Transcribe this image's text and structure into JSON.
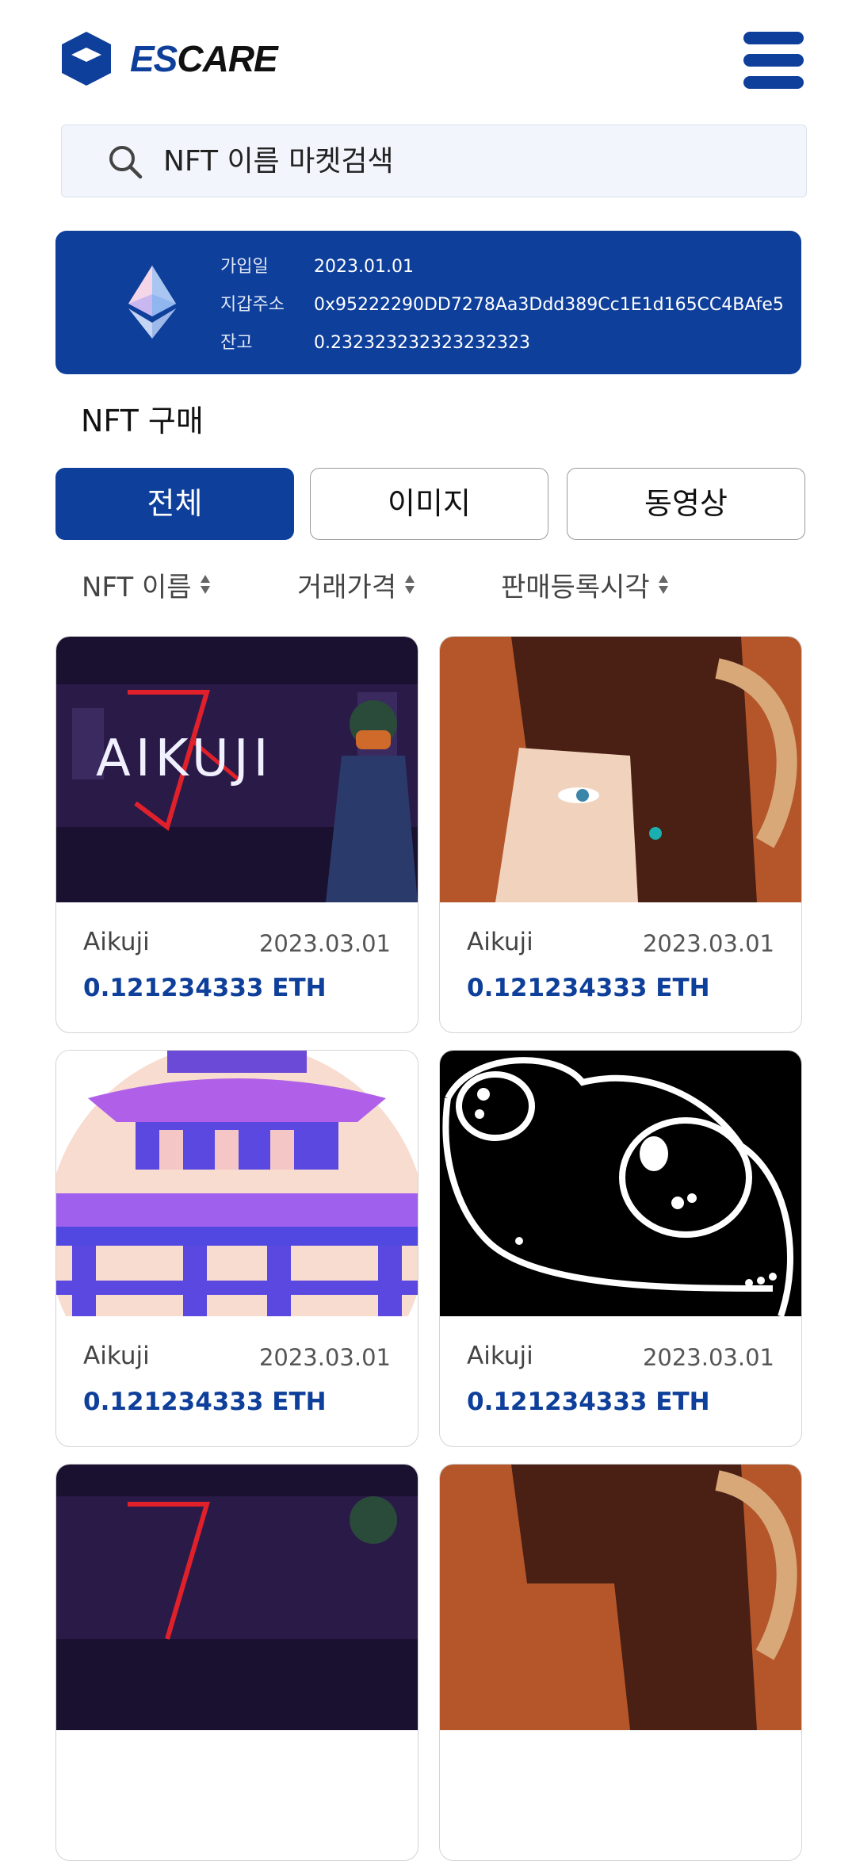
{
  "header": {
    "logo_es": "ES",
    "logo_care": "CARE",
    "menu_icon": "hamburger-menu-icon"
  },
  "search": {
    "placeholder": "NFT 이름 마켓검색",
    "icon": "search-icon"
  },
  "wallet": {
    "icon": "ethereum-icon",
    "rows": [
      {
        "label": "가입일",
        "value": "2023.01.01"
      },
      {
        "label": "지갑주소",
        "value": "0x95222290DD7278Aa3Ddd389Cc1E1d165CC4BAfe5"
      },
      {
        "label": "잔고",
        "value": "0.232323232323232323"
      }
    ]
  },
  "section_title": "NFT 구매",
  "tabs": [
    {
      "label": "전체",
      "active": true
    },
    {
      "label": "이미지",
      "active": false
    },
    {
      "label": "동영상",
      "active": false
    }
  ],
  "sort": [
    {
      "label": "NFT 이름"
    },
    {
      "label": "거래가격"
    },
    {
      "label": "판매등록시각"
    }
  ],
  "cards": [
    {
      "name": "Aikuji",
      "date": "2023.03.01",
      "price": "0.121234333 ETH",
      "image_text": "AIKUJI",
      "image": "aikuji-artwork"
    },
    {
      "name": "Aikuji",
      "date": "2023.03.01",
      "price": "0.121234333 ETH",
      "image": "portrait-artwork"
    },
    {
      "name": "Aikuji",
      "date": "2023.03.01",
      "price": "0.121234333 ETH",
      "image": "pagoda-artwork"
    },
    {
      "name": "Aikuji",
      "date": "2023.03.01",
      "price": "0.121234333 ETH",
      "image": "frog-artwork"
    },
    {
      "name": "",
      "date": "",
      "price": "",
      "image": "aikuji-artwork"
    },
    {
      "name": "",
      "date": "",
      "price": "",
      "image": "portrait-artwork"
    }
  ],
  "colors": {
    "brand": "#0e3f9a",
    "search_bg": "#f2f6fc",
    "price": "#0e3f9a"
  }
}
